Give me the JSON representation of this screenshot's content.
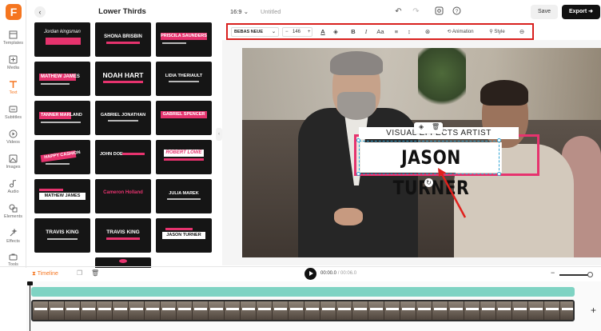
{
  "sidebar": {
    "items": [
      {
        "label": "Templates",
        "icon": "templates-icon"
      },
      {
        "label": "Media",
        "icon": "media-icon"
      },
      {
        "label": "Text",
        "icon": "text-icon",
        "active": true
      },
      {
        "label": "Subtitles",
        "icon": "subtitles-icon"
      },
      {
        "label": "Videos",
        "icon": "videos-icon"
      },
      {
        "label": "Images",
        "icon": "images-icon"
      },
      {
        "label": "Audio",
        "icon": "audio-icon"
      },
      {
        "label": "Elements",
        "icon": "elements-icon"
      },
      {
        "label": "Effects",
        "icon": "effects-icon"
      },
      {
        "label": "Tools",
        "icon": "tools-icon"
      }
    ]
  },
  "panel": {
    "title": "Lower Thirds",
    "tiles": [
      "Jordan kingsman",
      "SHONA BRISBIN",
      "PRISCILA SAUNDERS",
      "MATHEW JAMES",
      "NOAH HART",
      "LIDIA THERIAULT",
      "TANNER MARLAND",
      "GABRIEL JONATHAN",
      "GABRIEL SPENCER",
      "HAPPY CASHION",
      "JOHN DOE",
      "ROBERT LOWE",
      "MATHEW JAMES",
      "Cameron Holland",
      "JULIA MAREK",
      "TRAVIS KING",
      "TRAVIS KING",
      "JASON TURNER"
    ]
  },
  "topbar": {
    "ratio": "16:9",
    "doc_title": "Untitled",
    "save_label": "Save",
    "export_label": "Export"
  },
  "textbar": {
    "font": "BEBAS NEUE",
    "size": "146",
    "animation_label": "Animation",
    "style_label": "Style"
  },
  "canvas": {
    "subtitle_text": "VISUAL EFFECTS ARTIST",
    "name_text": "JASON TURNER",
    "accent": "#e6336e"
  },
  "timeline": {
    "label": "Timeline",
    "current_time": "00:00.0",
    "total_time": "/ 00:06.0"
  }
}
